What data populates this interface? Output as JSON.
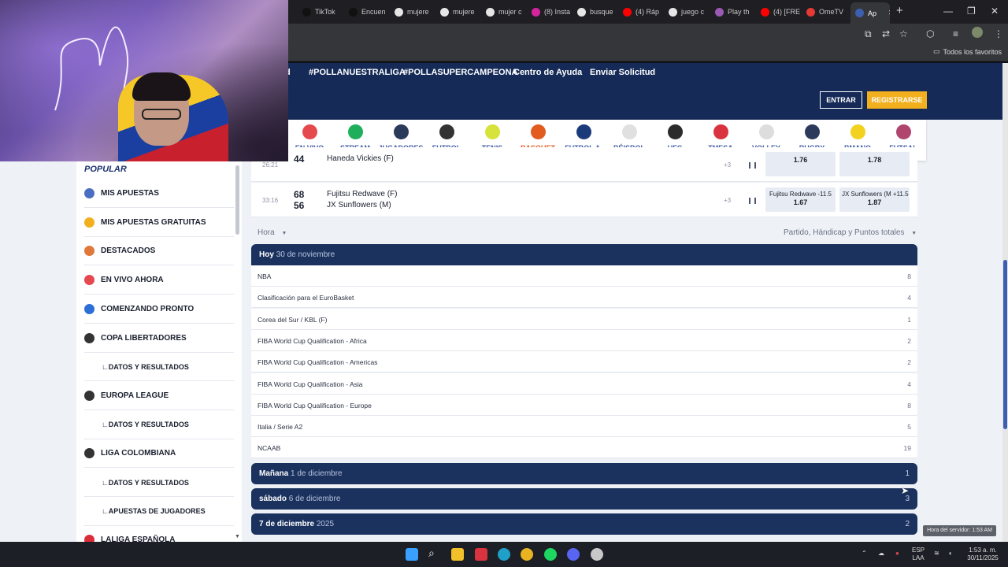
{
  "browser": {
    "tabs": [
      {
        "label": "TikTok",
        "color": "#111111"
      },
      {
        "label": "Encuen",
        "color": "#111111"
      },
      {
        "label": "mujere",
        "color": "#e6e6e6"
      },
      {
        "label": "mujere",
        "color": "#e6e6e6"
      },
      {
        "label": "mujer c",
        "color": "#e6e6e6"
      },
      {
        "label": "(8) Insta",
        "color": "#d6249f"
      },
      {
        "label": "busque",
        "color": "#e6e6e6"
      },
      {
        "label": "(4) Ráp",
        "color": "#ff0000"
      },
      {
        "label": "juego c",
        "color": "#e6e6e6"
      },
      {
        "label": "Play th",
        "color": "#9b59b6"
      },
      {
        "label": "(4) [FRE",
        "color": "#ff0000"
      },
      {
        "label": "OmeTV",
        "color": "#e53935"
      },
      {
        "label": "Ap",
        "color": "#3d5fb0"
      }
    ],
    "bookmarks_label": "Todos los favoritos"
  },
  "site": {
    "nav_links": [
      "d",
      "#POLLANUESTRALIGA",
      "#POLLASUPERCAMPEONA",
      "Centro de Ayuda",
      "Enviar Solicitud"
    ],
    "login_label": "ENTRAR",
    "register_label": "REGISTRARSE"
  },
  "sports": [
    {
      "label": "EN VIVO",
      "icon": "live-icon",
      "color": "#e5484d"
    },
    {
      "label": "STREAM",
      "icon": "stream-icon",
      "color": "#1fae5b"
    },
    {
      "label": "JUGADORES",
      "icon": "players-icon",
      "color": "#2b3a5a"
    },
    {
      "label": "FUTBOL",
      "icon": "soccer-ball-icon",
      "color": "#333333"
    },
    {
      "label": "TENIS",
      "icon": "tennis-ball-icon",
      "color": "#d7e23a"
    },
    {
      "label": "BASQUET",
      "icon": "basketball-icon",
      "color": "#e25b1f",
      "active": true
    },
    {
      "label": "FUTBOL A.",
      "icon": "nfl-icon",
      "color": "#1b3a7a"
    },
    {
      "label": "BÉISBOL",
      "icon": "baseball-icon",
      "color": "#e0e0e0"
    },
    {
      "label": "UFC",
      "icon": "glove-icon",
      "color": "#2b2b2b"
    },
    {
      "label": "TMESA",
      "icon": "ping-pong-icon",
      "color": "#d9333f"
    },
    {
      "label": "VOLLEY",
      "icon": "volleyball-icon",
      "color": "#dddddd"
    },
    {
      "label": "RUGBY",
      "icon": "rugby-ball-icon",
      "color": "#2b3a5a"
    },
    {
      "label": "BMANO",
      "icon": "handball-icon",
      "color": "#f2d11f"
    },
    {
      "label": "FUTSAL",
      "icon": "futsal-icon",
      "color": "#b0466d"
    }
  ],
  "sidebar": {
    "title": "POPULAR",
    "items": [
      {
        "label": "MIS APUESTAS",
        "icon": "betslip-icon",
        "color": "#4a6fc1"
      },
      {
        "label": "MIS APUESTAS GRATUITAS",
        "icon": "coin-icon",
        "color": "#f2b01e"
      },
      {
        "label": "DESTACADOS",
        "icon": "star-icon",
        "color": "#e0783a"
      },
      {
        "label": "EN VIVO AHORA",
        "icon": "live-icon",
        "color": "#e5484d"
      },
      {
        "label": "COMENZANDO PRONTO",
        "icon": "clock-icon",
        "color": "#2c6fd6"
      },
      {
        "label": "COPA LIBERTADORES",
        "icon": "soccer-ball-icon",
        "color": "#333333",
        "tv": true
      },
      {
        "label": "∟DATOS Y RESULTADOS",
        "sub": true
      },
      {
        "label": "EUROPA LEAGUE",
        "icon": "soccer-ball-icon",
        "color": "#333333"
      },
      {
        "label": "∟DATOS Y RESULTADOS",
        "sub": true
      },
      {
        "label": "LIGA COLOMBIANA",
        "icon": "soccer-ball-icon",
        "color": "#333333"
      },
      {
        "label": "∟DATOS Y RESULTADOS",
        "sub": true
      },
      {
        "label": "∟APUESTAS DE JUGADORES",
        "sub": true
      },
      {
        "label": "LALIGA ESPAÑOLA",
        "icon": "laliga-icon",
        "color": "#d92d3a",
        "tv": true
      }
    ]
  },
  "live_matches": [
    {
      "time": "26:21",
      "score_a": "",
      "score_b": "44",
      "team_a": "",
      "team_b": "Haneda Vickies (F)",
      "more": "+3",
      "odd1_label": "",
      "odd1_value": "1.76",
      "odd2_label": "",
      "odd2_value": "1.78"
    },
    {
      "time": "33:16",
      "score_a": "68",
      "score_b": "56",
      "team_a": "Fujitsu Redwave (F)",
      "team_b": "JX Sunflowers (M)",
      "more": "+3",
      "odd1_label": "Fujitsu Redwave  -11.5",
      "odd1_value": "1.67",
      "odd2_label": "JX Sunflowers (M  +11.5",
      "odd2_value": "1.87"
    }
  ],
  "filters": {
    "sort_label": "Hora",
    "market_label": "Partido, Hándicap y Puntos totales"
  },
  "days": [
    {
      "day": "Hoy",
      "date": "30 de noviembre",
      "count": "",
      "leagues": [
        {
          "name": "NBA",
          "count": "8"
        },
        {
          "name": "Clasificación para el EuroBasket",
          "count": "4"
        },
        {
          "name": "Corea del Sur / KBL (F)",
          "count": "1"
        },
        {
          "name": "FIBA World Cup Qualification - Africa",
          "count": "2"
        },
        {
          "name": "FIBA World Cup Qualification - Americas",
          "count": "2"
        },
        {
          "name": "FIBA World Cup Qualification - Asia",
          "count": "4"
        },
        {
          "name": "FIBA World Cup Qualification - Europe",
          "count": "8"
        },
        {
          "name": "Italia / Serie A2",
          "count": "5"
        },
        {
          "name": "NCAAB",
          "count": "19"
        }
      ]
    },
    {
      "day": "Mañana",
      "date": "1 de diciembre",
      "count": "1",
      "leagues": []
    },
    {
      "day": "sábado",
      "date": "6 de diciembre",
      "count": "3",
      "leagues": []
    },
    {
      "day": "7 de diciembre",
      "date": "2025",
      "count": "2",
      "leagues": []
    }
  ],
  "server_time": "Hora del servidor: 1:53 AM",
  "taskbar": {
    "lang_top": "ESP",
    "lang_bottom": "LAA",
    "time": "1:53 a. m.",
    "date": "30/11/2025"
  }
}
